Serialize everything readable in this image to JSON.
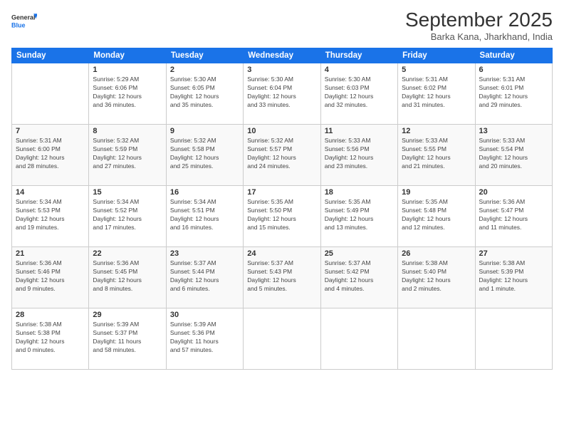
{
  "logo": {
    "line1": "General",
    "line2": "Blue"
  },
  "title": "September 2025",
  "subtitle": "Barka Kana, Jharkhand, India",
  "weekdays": [
    "Sunday",
    "Monday",
    "Tuesday",
    "Wednesday",
    "Thursday",
    "Friday",
    "Saturday"
  ],
  "weeks": [
    [
      {
        "day": "",
        "info": ""
      },
      {
        "day": "1",
        "info": "Sunrise: 5:29 AM\nSunset: 6:06 PM\nDaylight: 12 hours\nand 36 minutes."
      },
      {
        "day": "2",
        "info": "Sunrise: 5:30 AM\nSunset: 6:05 PM\nDaylight: 12 hours\nand 35 minutes."
      },
      {
        "day": "3",
        "info": "Sunrise: 5:30 AM\nSunset: 6:04 PM\nDaylight: 12 hours\nand 33 minutes."
      },
      {
        "day": "4",
        "info": "Sunrise: 5:30 AM\nSunset: 6:03 PM\nDaylight: 12 hours\nand 32 minutes."
      },
      {
        "day": "5",
        "info": "Sunrise: 5:31 AM\nSunset: 6:02 PM\nDaylight: 12 hours\nand 31 minutes."
      },
      {
        "day": "6",
        "info": "Sunrise: 5:31 AM\nSunset: 6:01 PM\nDaylight: 12 hours\nand 29 minutes."
      }
    ],
    [
      {
        "day": "7",
        "info": "Sunrise: 5:31 AM\nSunset: 6:00 PM\nDaylight: 12 hours\nand 28 minutes."
      },
      {
        "day": "8",
        "info": "Sunrise: 5:32 AM\nSunset: 5:59 PM\nDaylight: 12 hours\nand 27 minutes."
      },
      {
        "day": "9",
        "info": "Sunrise: 5:32 AM\nSunset: 5:58 PM\nDaylight: 12 hours\nand 25 minutes."
      },
      {
        "day": "10",
        "info": "Sunrise: 5:32 AM\nSunset: 5:57 PM\nDaylight: 12 hours\nand 24 minutes."
      },
      {
        "day": "11",
        "info": "Sunrise: 5:33 AM\nSunset: 5:56 PM\nDaylight: 12 hours\nand 23 minutes."
      },
      {
        "day": "12",
        "info": "Sunrise: 5:33 AM\nSunset: 5:55 PM\nDaylight: 12 hours\nand 21 minutes."
      },
      {
        "day": "13",
        "info": "Sunrise: 5:33 AM\nSunset: 5:54 PM\nDaylight: 12 hours\nand 20 minutes."
      }
    ],
    [
      {
        "day": "14",
        "info": "Sunrise: 5:34 AM\nSunset: 5:53 PM\nDaylight: 12 hours\nand 19 minutes."
      },
      {
        "day": "15",
        "info": "Sunrise: 5:34 AM\nSunset: 5:52 PM\nDaylight: 12 hours\nand 17 minutes."
      },
      {
        "day": "16",
        "info": "Sunrise: 5:34 AM\nSunset: 5:51 PM\nDaylight: 12 hours\nand 16 minutes."
      },
      {
        "day": "17",
        "info": "Sunrise: 5:35 AM\nSunset: 5:50 PM\nDaylight: 12 hours\nand 15 minutes."
      },
      {
        "day": "18",
        "info": "Sunrise: 5:35 AM\nSunset: 5:49 PM\nDaylight: 12 hours\nand 13 minutes."
      },
      {
        "day": "19",
        "info": "Sunrise: 5:35 AM\nSunset: 5:48 PM\nDaylight: 12 hours\nand 12 minutes."
      },
      {
        "day": "20",
        "info": "Sunrise: 5:36 AM\nSunset: 5:47 PM\nDaylight: 12 hours\nand 11 minutes."
      }
    ],
    [
      {
        "day": "21",
        "info": "Sunrise: 5:36 AM\nSunset: 5:46 PM\nDaylight: 12 hours\nand 9 minutes."
      },
      {
        "day": "22",
        "info": "Sunrise: 5:36 AM\nSunset: 5:45 PM\nDaylight: 12 hours\nand 8 minutes."
      },
      {
        "day": "23",
        "info": "Sunrise: 5:37 AM\nSunset: 5:44 PM\nDaylight: 12 hours\nand 6 minutes."
      },
      {
        "day": "24",
        "info": "Sunrise: 5:37 AM\nSunset: 5:43 PM\nDaylight: 12 hours\nand 5 minutes."
      },
      {
        "day": "25",
        "info": "Sunrise: 5:37 AM\nSunset: 5:42 PM\nDaylight: 12 hours\nand 4 minutes."
      },
      {
        "day": "26",
        "info": "Sunrise: 5:38 AM\nSunset: 5:40 PM\nDaylight: 12 hours\nand 2 minutes."
      },
      {
        "day": "27",
        "info": "Sunrise: 5:38 AM\nSunset: 5:39 PM\nDaylight: 12 hours\nand 1 minute."
      }
    ],
    [
      {
        "day": "28",
        "info": "Sunrise: 5:38 AM\nSunset: 5:38 PM\nDaylight: 12 hours\nand 0 minutes."
      },
      {
        "day": "29",
        "info": "Sunrise: 5:39 AM\nSunset: 5:37 PM\nDaylight: 11 hours\nand 58 minutes."
      },
      {
        "day": "30",
        "info": "Sunrise: 5:39 AM\nSunset: 5:36 PM\nDaylight: 11 hours\nand 57 minutes."
      },
      {
        "day": "",
        "info": ""
      },
      {
        "day": "",
        "info": ""
      },
      {
        "day": "",
        "info": ""
      },
      {
        "day": "",
        "info": ""
      }
    ]
  ]
}
